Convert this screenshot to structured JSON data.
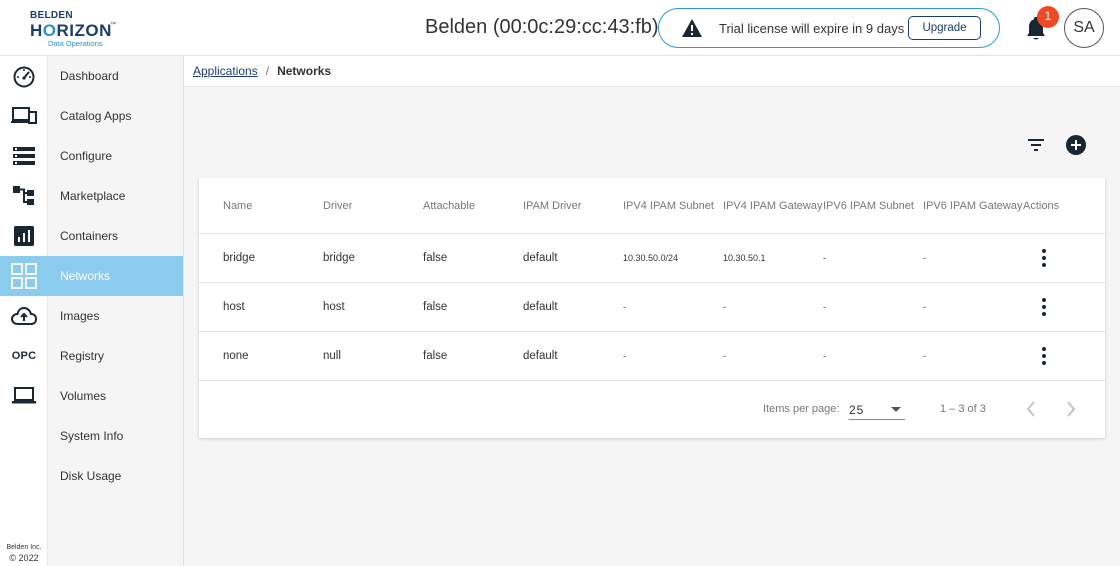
{
  "header": {
    "logo_line1": "BELDEN",
    "logo_line2a": "H",
    "logo_line2b": "RIZON",
    "logo_line3": "Data Operations",
    "logo_tm": "™",
    "device_title": "Belden (00:0c:29:cc:43:fb)",
    "trial_text": "Trial license will expire in 9 days",
    "upgrade_label": "Upgrade",
    "notification_count": "1",
    "avatar_initials": "SA"
  },
  "rail": {
    "opc_label": "OPC",
    "footer_company": "Belden Inc.",
    "footer_copyright": "© 2022"
  },
  "nav": {
    "items": [
      {
        "label": "Dashboard"
      },
      {
        "label": "Catalog Apps"
      },
      {
        "label": "Configure"
      },
      {
        "label": "Marketplace"
      },
      {
        "label": "Containers"
      },
      {
        "label": "Networks"
      },
      {
        "label": "Images"
      },
      {
        "label": "Registry"
      },
      {
        "label": "Volumes"
      },
      {
        "label": "System Info"
      },
      {
        "label": "Disk Usage"
      }
    ],
    "active_index": 5
  },
  "breadcrumb": {
    "parent": "Applications",
    "separator": "/",
    "current": "Networks"
  },
  "table": {
    "columns": [
      "Name",
      "Driver",
      "Attachable",
      "IPAM Driver",
      "IPV4 IPAM Subnet",
      "IPV4 IPAM Gateway",
      "IPV6 IPAM Subnet",
      "IPV6 IPAM Gateway",
      "Actions"
    ],
    "rows": [
      {
        "name": "bridge",
        "driver": "bridge",
        "attachable": "false",
        "ipam_driver": "default",
        "ipv4_subnet": "10.30.50.0/24",
        "ipv4_gateway": "10.30.50.1",
        "ipv6_subnet": "-",
        "ipv6_gateway": "-"
      },
      {
        "name": "host",
        "driver": "host",
        "attachable": "false",
        "ipam_driver": "default",
        "ipv4_subnet": "-",
        "ipv4_gateway": "-",
        "ipv6_subnet": "-",
        "ipv6_gateway": "-"
      },
      {
        "name": "none",
        "driver": "null",
        "attachable": "false",
        "ipam_driver": "default",
        "ipv4_subnet": "-",
        "ipv4_gateway": "-",
        "ipv6_subnet": "-",
        "ipv6_gateway": "-"
      }
    ]
  },
  "pager": {
    "items_per_page_label": "Items per page:",
    "items_per_page_value": "25",
    "range_label": "1 – 3 of 3"
  },
  "colors": {
    "accent_active": "#8acbee",
    "brand_navy": "#1d3c6e",
    "brand_blue": "#2a9bd0",
    "badge_red": "#ef4a23"
  },
  "icons": {
    "rail": [
      "dashboard-gauge-icon",
      "devices-icon",
      "configure-list-icon",
      "marketplace-hierarchy-icon",
      "containers-chart-icon",
      "networks-grid-icon",
      "images-cloud-upload-icon",
      "opc-text-icon",
      "volumes-laptop-icon"
    ],
    "toolbar": [
      "filter-icon",
      "add-circle-icon"
    ],
    "row_actions": "kebab-menu-icon"
  }
}
